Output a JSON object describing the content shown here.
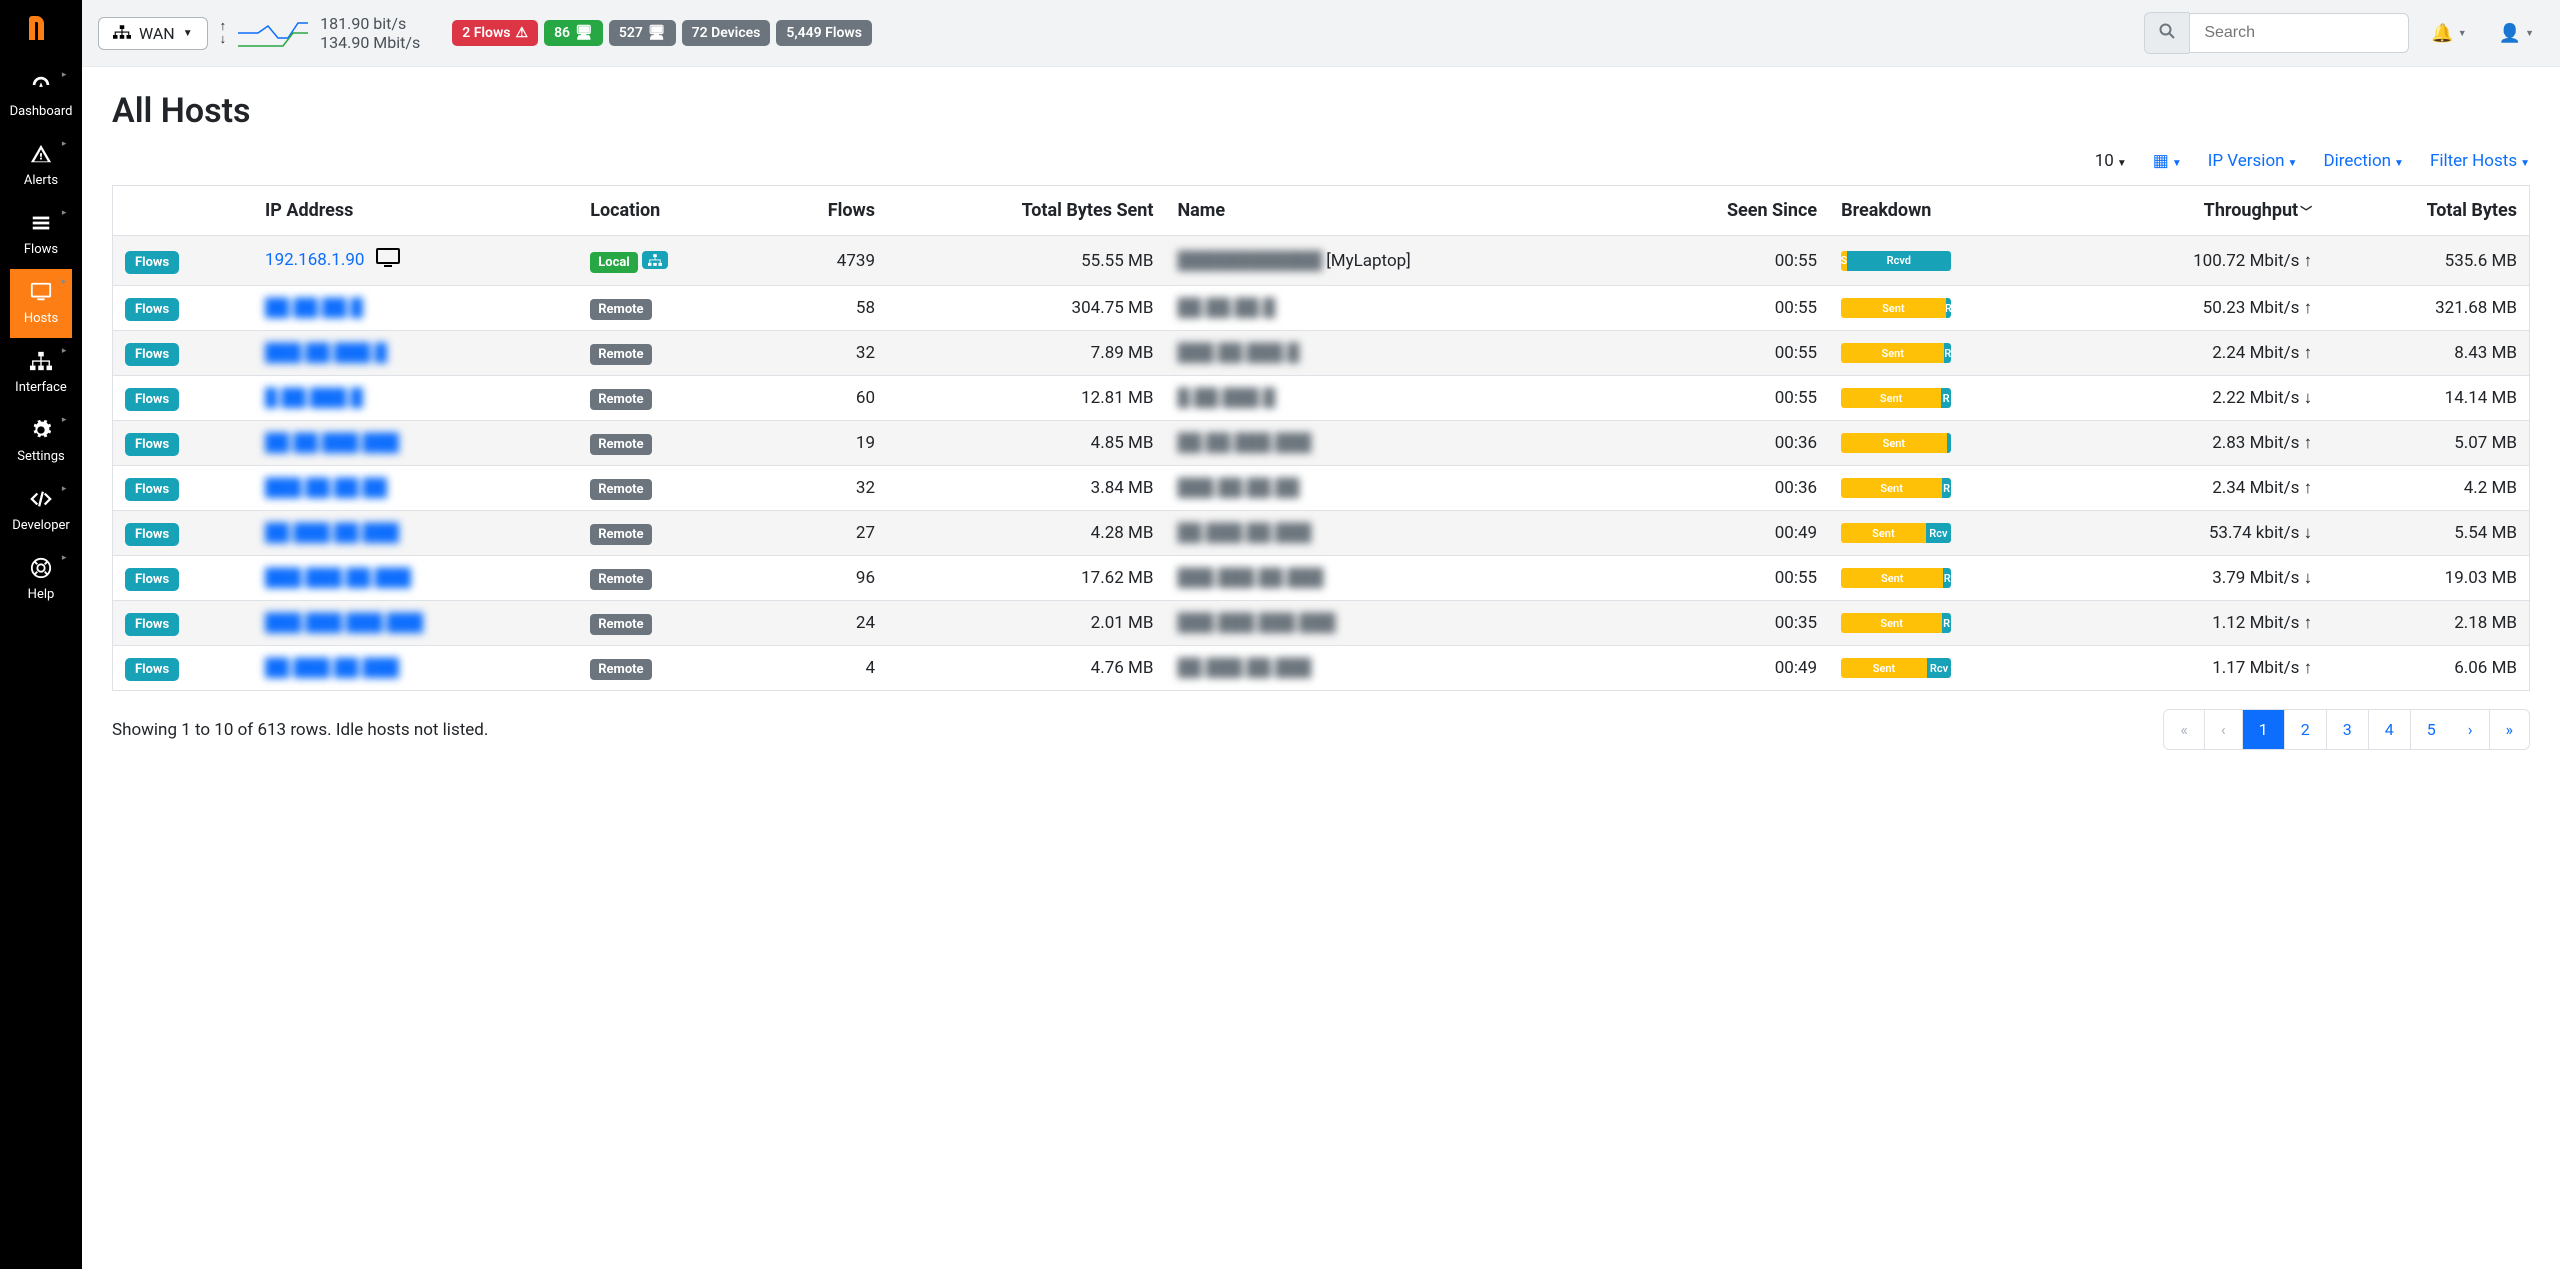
{
  "sidebar": {
    "items": [
      {
        "label": "Dashboard",
        "icon": "dashboard"
      },
      {
        "label": "Alerts",
        "icon": "alert"
      },
      {
        "label": "Flows",
        "icon": "flows"
      },
      {
        "label": "Hosts",
        "icon": "hosts",
        "active": true
      },
      {
        "label": "Interface",
        "icon": "interface"
      },
      {
        "label": "Settings",
        "icon": "settings"
      },
      {
        "label": "Developer",
        "icon": "developer"
      },
      {
        "label": "Help",
        "icon": "help"
      }
    ]
  },
  "topbar": {
    "interface": "WAN",
    "up_rate": "181.90 bit/s",
    "down_rate": "134.90 Mbit/s",
    "badges": {
      "flows_alert": "2 Flows",
      "count_green": "86",
      "count_gray1": "527",
      "devices": "72 Devices",
      "flows_total": "5,449 Flows"
    },
    "search_placeholder": "Search"
  },
  "page": {
    "title": "All Hosts",
    "filters": {
      "page_size": "10",
      "ip_version": "IP Version",
      "direction": "Direction",
      "filter_hosts": "Filter Hosts"
    }
  },
  "columns": {
    "flows_btn": "Flows",
    "ip": "IP Address",
    "location": "Location",
    "flows": "Flows",
    "total_sent": "Total Bytes Sent",
    "name": "Name",
    "seen_since": "Seen Since",
    "breakdown": "Breakdown",
    "throughput": "Throughput",
    "total_bytes": "Total Bytes"
  },
  "location_labels": {
    "local": "Local",
    "remote": "Remote"
  },
  "breakdown_labels": {
    "sent": "Sent",
    "rcvd": "Rcvd"
  },
  "rows": [
    {
      "ip": "192.168.1.90",
      "ip_visible": true,
      "host_icons": true,
      "loc": "local",
      "flows": "4739",
      "sent": "55.55 MB",
      "name": "[MyLaptop]",
      "name_blurred_prefix": "████████████",
      "seen": "00:55",
      "brk_sent": 5,
      "brk_rcvd": 95,
      "thr": "100.72 Mbit/s",
      "dir": "up",
      "total": "535.6 MB"
    },
    {
      "ip": "██.██.██.█",
      "loc": "remote",
      "flows": "58",
      "sent": "304.75 MB",
      "name": "██.██.██.█",
      "seen": "00:55",
      "brk_sent": 95,
      "brk_rcvd": 5,
      "thr": "50.23 Mbit/s",
      "dir": "up",
      "total": "321.68 MB"
    },
    {
      "ip": "███.██.███.█",
      "loc": "remote",
      "flows": "32",
      "sent": "7.89 MB",
      "name": "███.██.███.█",
      "seen": "00:55",
      "brk_sent": 94,
      "brk_rcvd": 6,
      "thr": "2.24 Mbit/s",
      "dir": "up",
      "total": "8.43 MB"
    },
    {
      "ip": "█.██.███.█",
      "loc": "remote",
      "flows": "60",
      "sent": "12.81 MB",
      "name": "█.██.███.█",
      "seen": "00:55",
      "brk_sent": 91,
      "brk_rcvd": 9,
      "thr": "2.22 Mbit/s",
      "dir": "down",
      "total": "14.14 MB"
    },
    {
      "ip": "██.██.███.███",
      "loc": "remote",
      "flows": "19",
      "sent": "4.85 MB",
      "name": "██.██.███.███",
      "seen": "00:36",
      "brk_sent": 96,
      "brk_rcvd": 4,
      "thr": "2.83 Mbit/s",
      "dir": "up",
      "total": "5.07 MB"
    },
    {
      "ip": "███.██.██.██",
      "loc": "remote",
      "flows": "32",
      "sent": "3.84 MB",
      "name": "███.██.██.██",
      "seen": "00:36",
      "brk_sent": 92,
      "brk_rcvd": 8,
      "thr": "2.34 Mbit/s",
      "dir": "up",
      "total": "4.2 MB"
    },
    {
      "ip": "██.███.██.███",
      "loc": "remote",
      "flows": "27",
      "sent": "4.28 MB",
      "name": "██.███.██.███",
      "seen": "00:49",
      "brk_sent": 77,
      "brk_rcvd": 23,
      "thr": "53.74 kbit/s",
      "dir": "down",
      "total": "5.54 MB"
    },
    {
      "ip": "███.███.██.███",
      "loc": "remote",
      "flows": "96",
      "sent": "17.62 MB",
      "name": "███.███.██.███",
      "seen": "00:55",
      "brk_sent": 93,
      "brk_rcvd": 7,
      "thr": "3.79 Mbit/s",
      "dir": "down",
      "total": "19.03 MB"
    },
    {
      "ip": "███.███.███.███",
      "loc": "remote",
      "flows": "24",
      "sent": "2.01 MB",
      "name": "███.███.███.███",
      "seen": "00:35",
      "brk_sent": 92,
      "brk_rcvd": 8,
      "thr": "1.12 Mbit/s",
      "dir": "up",
      "total": "2.18 MB"
    },
    {
      "ip": "██.███.██.███",
      "loc": "remote",
      "flows": "4",
      "sent": "4.76 MB",
      "name": "██.███.██.███",
      "seen": "00:49",
      "brk_sent": 78,
      "brk_rcvd": 22,
      "thr": "1.17 Mbit/s",
      "dir": "up",
      "total": "6.06 MB"
    }
  ],
  "footer": {
    "summary": "Showing 1 to 10 of 613 rows. Idle hosts not listed.",
    "pages": [
      "1",
      "2",
      "3",
      "4",
      "5"
    ],
    "active_page": "1"
  }
}
